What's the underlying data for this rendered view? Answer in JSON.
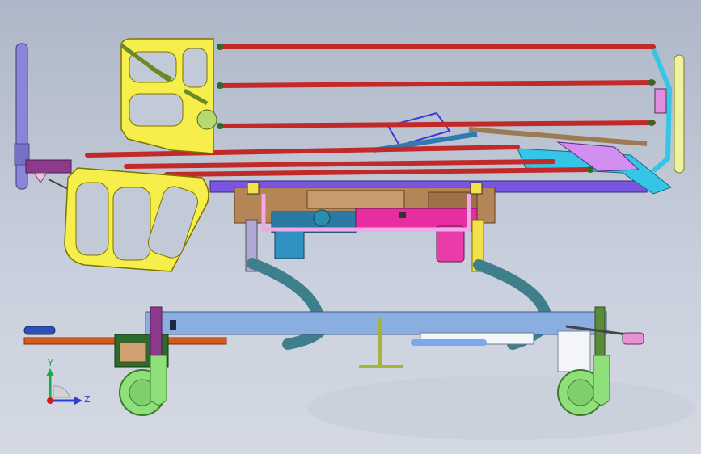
{
  "viewport": {
    "background": "#c3cad7",
    "colors": {
      "frame_blue": "#5b78c9",
      "side_rail_red": "#c22a2a",
      "headboard_yellow": "#f6ee4a",
      "base_blue": "#8aaee0",
      "motor_pink": "#e62ea0",
      "motor_teal": "#2c7aa3",
      "arm_teal": "#3f7f8c",
      "wheel_green": "#8fe07a",
      "push_bar_orange": "#d25a1e",
      "deck_tan": "#b48556",
      "cyan_link": "#35c5e6",
      "purple_post": "#8b85d8"
    }
  },
  "triad": {
    "y_label": "Y",
    "z_label": "Z",
    "y_icon": "axis-y-arrow",
    "z_icon": "axis-z-arrow"
  }
}
